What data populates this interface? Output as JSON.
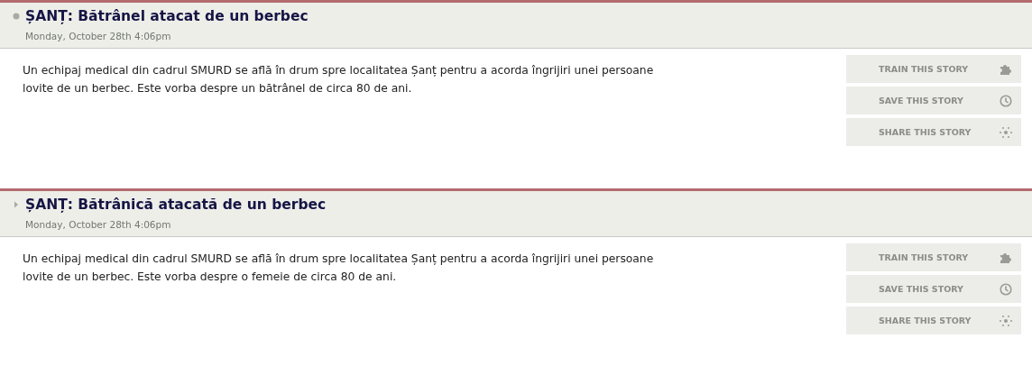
{
  "stories": [
    {
      "kind": "dot",
      "title": "ȘANȚ: Bătrânel atacat de un berbec",
      "date": "Monday, October 28th 4:06pm",
      "text": "Un echipaj medical din cadrul SMURD se află în drum spre localitatea Șanț pentru a acorda îngrijiri unei persoane lovite de un berbec. Este vorba despre un bătrânel de circa 80 de ani.",
      "actions": [
        {
          "label": "TRAIN THIS STORY",
          "kind": "train"
        },
        {
          "label": "SAVE THIS STORY",
          "kind": "save"
        },
        {
          "label": "SHARE THIS STORY",
          "kind": "share"
        }
      ]
    },
    {
      "kind": "arrow",
      "title": "ȘANȚ: Bătrânică atacată de un berbec",
      "date": "Monday, October 28th 4:06pm",
      "text": "Un echipaj medical din cadrul SMURD se află în drum spre localitatea Șanț pentru a acorda îngrijiri unei persoane lovite de un berbec. Este vorba despre o femeie de circa 80 de ani.",
      "actions": [
        {
          "label": "TRAIN THIS STORY",
          "kind": "train"
        },
        {
          "label": "SAVE THIS STORY",
          "kind": "save"
        },
        {
          "label": "SHARE THIS STORY",
          "kind": "share"
        }
      ]
    }
  ]
}
